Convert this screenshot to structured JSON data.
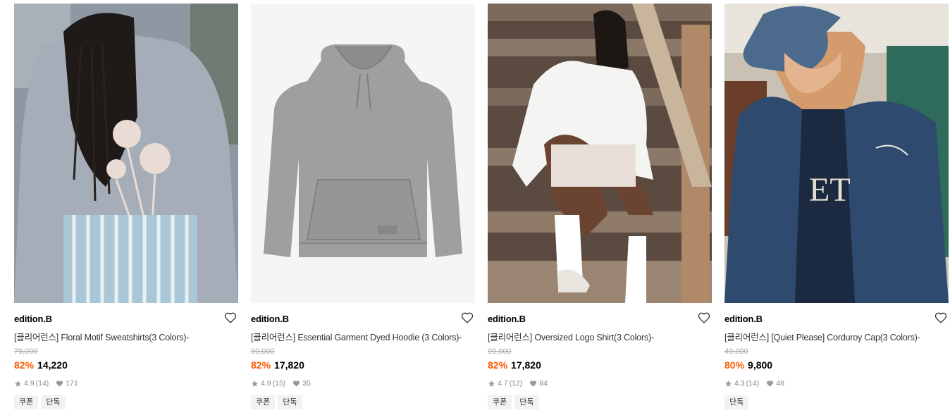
{
  "colors": {
    "discount": "#ff5a00",
    "strike": "#aaaaaa",
    "meta": "#888888",
    "tag_bg": "#f2f2f2"
  },
  "products": [
    {
      "brand": "edition.B",
      "name": "[클리어런스] Floral Motif Sweatshirts(3 Colors)-",
      "original_price": "79,000",
      "discount": "82%",
      "price": "14,220",
      "rating": "4.9",
      "reviews": "(14)",
      "likes": "171",
      "tags": [
        "쿠폰",
        "단독"
      ],
      "image": "grey sweatshirt with floral motif, back view"
    },
    {
      "brand": "edition.B",
      "name": "[클리어런스] Essential Garment Dyed Hoodie (3 Colors)-",
      "original_price": "99,000",
      "discount": "82%",
      "price": "17,820",
      "rating": "4.9",
      "reviews": "(15)",
      "likes": "35",
      "tags": [
        "쿠폰",
        "단독"
      ],
      "image": "grey hoodie product shot"
    },
    {
      "brand": "edition.B",
      "name": "[클리어런스] Oversized Logo Shirt(3 Colors)-",
      "original_price": "99,000",
      "discount": "82%",
      "price": "17,820",
      "rating": "4.7",
      "reviews": "(12)",
      "likes": "84",
      "tags": [
        "쿠폰",
        "단독"
      ],
      "image": "model in white shirt on wooden stairs"
    },
    {
      "brand": "edition.B",
      "name": "[클리어런스] [Quiet Please] Corduroy Cap(3 Colors)-",
      "original_price": "49,000",
      "discount": "80%",
      "price": "9,800",
      "rating": "4.3",
      "reviews": "(14)",
      "likes": "48",
      "tags": [
        "단독"
      ],
      "image": "model wearing navy corduroy cap and jacket"
    }
  ]
}
